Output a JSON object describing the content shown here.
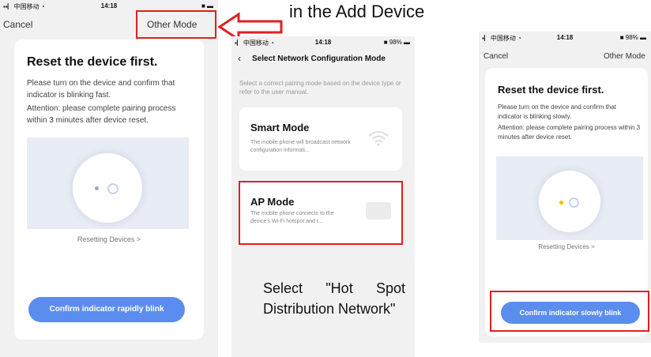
{
  "status": {
    "carrier": "中国移动",
    "time": "14:18",
    "battery": "98%"
  },
  "left_phone": {
    "cancel": "Cancel",
    "other_mode": "Other Mode",
    "title": "Reset the device first.",
    "desc1": "Please turn on the device and confirm that indicator is blinking fast.",
    "desc2": "Attention: please complete pairing process within 3 minutes after device reset.",
    "resetting": "Resetting Devices >",
    "confirm": "Confirm indicator rapidly blink"
  },
  "annotation": {
    "caption_line1": "in the Add Device",
    "caption_select": "Select \"Hot Spot Distribution Network\""
  },
  "middle_phone": {
    "back_icon": "chevron-left-icon",
    "title": "Select Network Configuration Mode",
    "hint": "Select a correct pairing mode based on the device type or refer to the user manual.",
    "smart_title": "Smart Mode",
    "smart_desc": "The mobile phone will broadcast network configuration informati...",
    "ap_title": "AP Mode",
    "ap_desc": "The mobile phone connects to the device's Wi-Fi hotspot and t..."
  },
  "right_phone": {
    "cancel": "Cancel",
    "other_mode": "Other Mode",
    "title": "Reset the device first.",
    "desc1": "Please turn on the device and confirm that indicator is blinking slowly.",
    "desc2": "Attention: please complete pairing process within 3 minutes after device reset.",
    "resetting": "Resetting Devices >",
    "confirm": "Confirm indicator slowly blink"
  },
  "colors": {
    "accent": "#5b8def",
    "highlight": "#e02020"
  }
}
